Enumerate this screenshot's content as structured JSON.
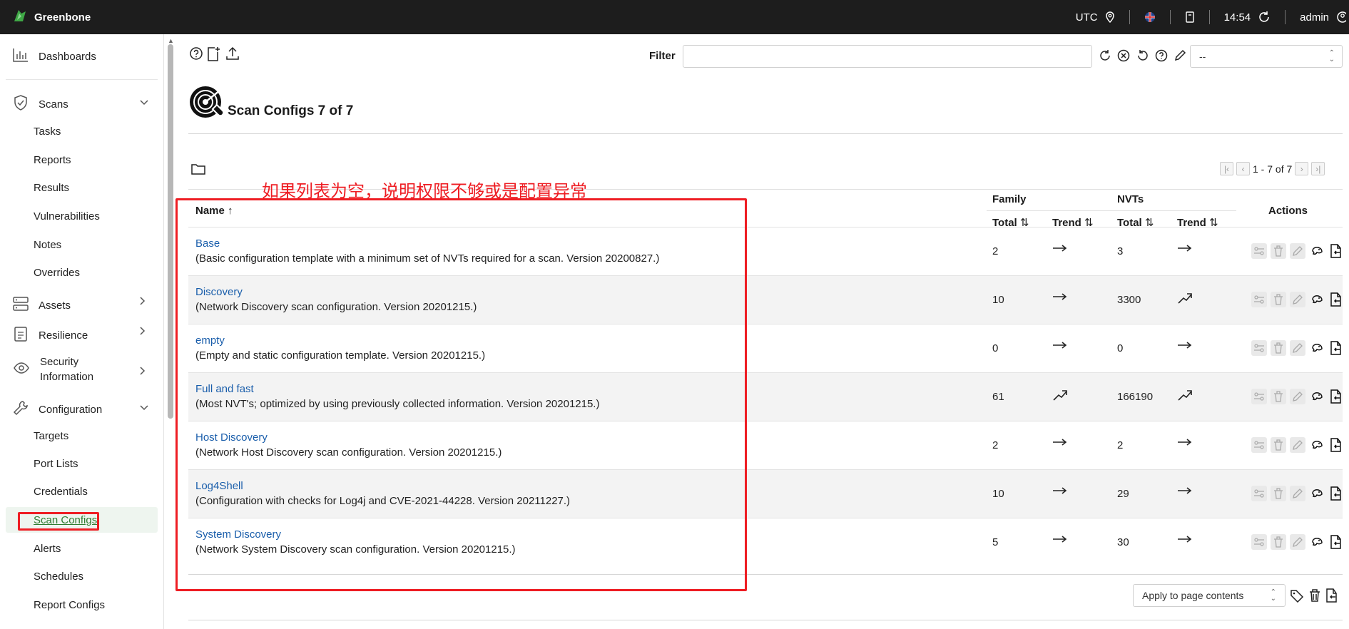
{
  "topbar": {
    "brand": "Greenbone",
    "timezone": "UTC",
    "time": "14:54",
    "user": "admin"
  },
  "sidebar": {
    "dashboards": "Dashboards",
    "scans": "Scans",
    "scans_items": [
      "Tasks",
      "Reports",
      "Results",
      "Vulnerabilities",
      "Notes",
      "Overrides"
    ],
    "assets": "Assets",
    "resilience": "Resilience",
    "security_info_line1": "Security",
    "security_info_line2": "Information",
    "configuration": "Configuration",
    "config_items": [
      "Targets",
      "Port Lists",
      "Credentials",
      "Scan Configs",
      "Alerts",
      "Schedules",
      "Report Configs"
    ]
  },
  "filter": {
    "label": "Filter",
    "value": "",
    "select_value": "--"
  },
  "page": {
    "title": "Scan Configs 7 of 7",
    "pager_text": "1 - 7 of 7"
  },
  "table": {
    "headers": {
      "name": "Name",
      "family": "Family",
      "nvts": "NVTs",
      "actions": "Actions",
      "total": "Total",
      "trend": "Trend"
    },
    "rows": [
      {
        "name": "Base",
        "desc": "(Basic configuration template with a minimum set of NVTs required for a scan. Version 20200827.)",
        "family_total": "2",
        "family_trend": "flat",
        "nvt_total": "3",
        "nvt_trend": "flat"
      },
      {
        "name": "Discovery",
        "desc": "(Network Discovery scan configuration. Version 20201215.)",
        "family_total": "10",
        "family_trend": "flat",
        "nvt_total": "3300",
        "nvt_trend": "up"
      },
      {
        "name": "empty",
        "desc": "(Empty and static configuration template. Version 20201215.)",
        "family_total": "0",
        "family_trend": "flat",
        "nvt_total": "0",
        "nvt_trend": "flat"
      },
      {
        "name": "Full and fast",
        "desc": "(Most NVT's; optimized by using previously collected information. Version 20201215.)",
        "family_total": "61",
        "family_trend": "up",
        "nvt_total": "166190",
        "nvt_trend": "up"
      },
      {
        "name": "Host Discovery",
        "desc": "(Network Host Discovery scan configuration. Version 20201215.)",
        "family_total": "2",
        "family_trend": "flat",
        "nvt_total": "2",
        "nvt_trend": "flat"
      },
      {
        "name": "Log4Shell",
        "desc": "(Configuration with checks for Log4j and CVE-2021-44228. Version 20211227.)",
        "family_total": "10",
        "family_trend": "flat",
        "nvt_total": "29",
        "nvt_trend": "flat"
      },
      {
        "name": "System Discovery",
        "desc": "(Network System Discovery scan configuration. Version 20201215.)",
        "family_total": "5",
        "family_trend": "flat",
        "nvt_total": "30",
        "nvt_trend": "flat"
      }
    ]
  },
  "bulk": {
    "apply_value": "Apply to page contents"
  },
  "annotation": {
    "text": "如果列表为空，说明权限不够或是配置异常"
  },
  "colors": {
    "accent": "#2f7d32",
    "link": "#1a5eab",
    "annotation": "#ee1d23",
    "topbar": "#1d1d1d"
  }
}
